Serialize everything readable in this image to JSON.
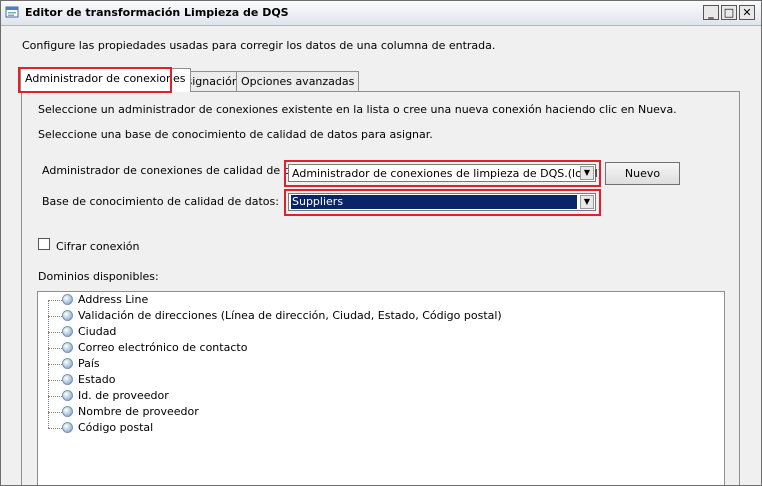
{
  "window": {
    "title": "Editor de transformación Limpieza de DQS",
    "minimize_glyph": "_",
    "maximize_glyph": "□",
    "close_glyph": "✕",
    "icon": "app-window-icon"
  },
  "description": "Configure las propiedades usadas para corregir los datos de una columna de entrada.",
  "tabs": [
    {
      "label": "Administrador de conexiones",
      "active": true
    },
    {
      "label": "Asignación",
      "active": false
    },
    {
      "label": "Opciones avanzadas",
      "active": false
    }
  ],
  "panel": {
    "intro_1": "Seleccione un administrador de conexiones existente en la lista o cree una nueva conexión haciendo clic en Nueva.",
    "intro_2": "Seleccione una base de conocimiento de calidad de datos para asignar.",
    "connection_manager": {
      "label": "Administrador de conexiones de calidad de datos:",
      "value": "Administrador de conexiones de limpieza de DQS.(local)",
      "new_button": "Nuevo"
    },
    "knowledge_base": {
      "label": "Base de conocimiento de calidad de datos:",
      "value": "Suppliers"
    },
    "encrypt": {
      "label": "Cifrar conexión",
      "checked": false
    },
    "domains": {
      "label": "Dominios disponibles:",
      "items": [
        "Address Line",
        "Validación de direcciones (Línea de dirección, Ciudad, Estado, Código postal)",
        "Ciudad",
        "Correo electrónico de contacto",
        "País",
        "Estado",
        "Id. de proveedor",
        "Nombre de proveedor",
        "Código postal"
      ]
    }
  },
  "colors": {
    "highlight": "#e0202a",
    "selection": "#0a246a"
  }
}
